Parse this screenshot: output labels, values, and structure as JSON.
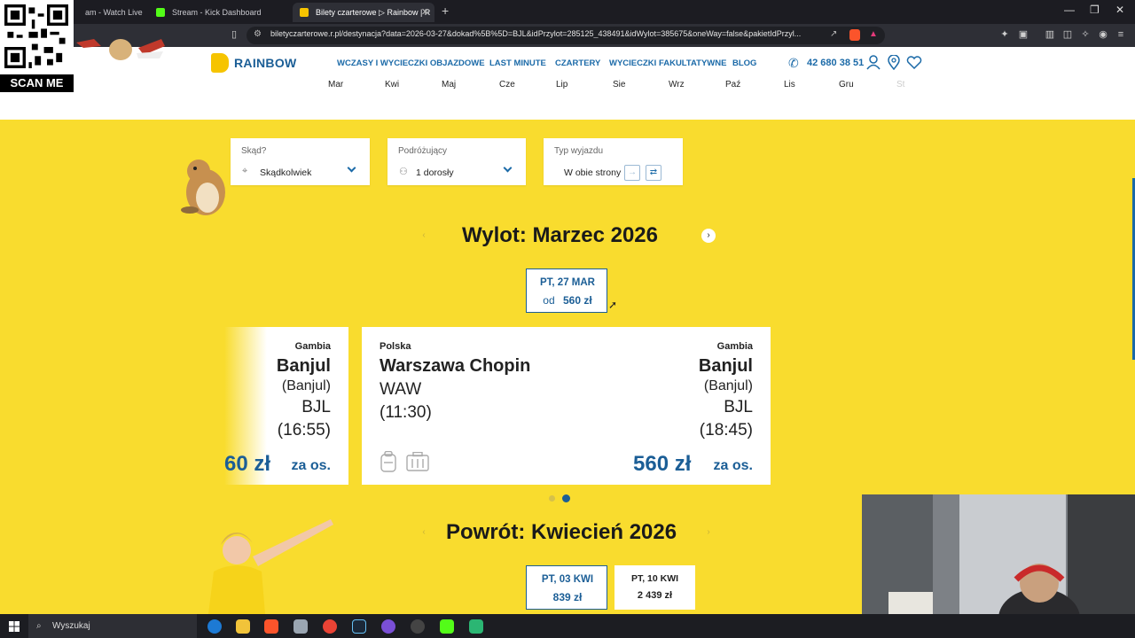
{
  "browser": {
    "tabs": [
      {
        "label": "am - Watch Live on K",
        "active": false
      },
      {
        "label": "Stream - Kick Dashboard",
        "active": false
      },
      {
        "label": "Bilety czarterowe ▷ Rainbow | R",
        "active": true
      }
    ],
    "url": "biletyczarterowe.r.pl/destynacja?data=2026-03-27&dokad%5B%5D=BJL&idPrzylot=285125_438491&idWylot=385675&oneWay=false&pakietIdPrzyl..."
  },
  "site": {
    "logo": "RAINBOW",
    "nav": [
      "WCZASY I WYCIECZKI OBJAZDOWE",
      "LAST MINUTE",
      "CZARTERY",
      "WYCIECZKI FAKULTATYWNE",
      "BLOG"
    ],
    "phone": "42 680 38 51",
    "months": [
      "Mar",
      "Kwi",
      "Maj",
      "Cze",
      "Lip",
      "Sie",
      "Wrz",
      "Paź",
      "Lis",
      "Gru",
      "St"
    ]
  },
  "search": {
    "from_label": "Skąd?",
    "from_value": "Skądkolwiek",
    "travelers_label": "Podróżujący",
    "travelers_value": "1 dorosły",
    "trip_label": "Typ wyjazdu",
    "trip_value": "W obie strony"
  },
  "outbound": {
    "heading": "Wylot: Marzec 2026",
    "date": {
      "day": "PT, 27 MAR",
      "prefix": "od",
      "price": "560 zł"
    }
  },
  "cards": [
    {
      "dest_country": "Gambia",
      "dest_city": "Banjul",
      "dest_sub": "(Banjul)",
      "dest_code": "BJL",
      "dest_time": "(16:55)",
      "price": "60 zł",
      "per": "za os."
    },
    {
      "origin_country": "Polska",
      "origin_city": "Warszawa Chopin",
      "origin_code": "WAW",
      "origin_time": "(11:30)",
      "dest_country": "Gambia",
      "dest_city": "Banjul",
      "dest_sub": "(Banjul)",
      "dest_code": "BJL",
      "dest_time": "(18:45)",
      "price": "560 zł",
      "per": "za os."
    }
  ],
  "return": {
    "heading": "Powrót: Kwiecień 2026",
    "dates": [
      {
        "day": "PT, 03 KWI",
        "price": "839 zł"
      },
      {
        "day": "PT, 10 KWI",
        "price": "2 439 zł"
      }
    ]
  },
  "overlay": {
    "scan_label": "SCAN ME"
  },
  "taskbar": {
    "search_placeholder": "Wyszukaj"
  },
  "colors": {
    "brand_blue": "#1b5e96",
    "brand_yellow": "#f9dc2e"
  }
}
